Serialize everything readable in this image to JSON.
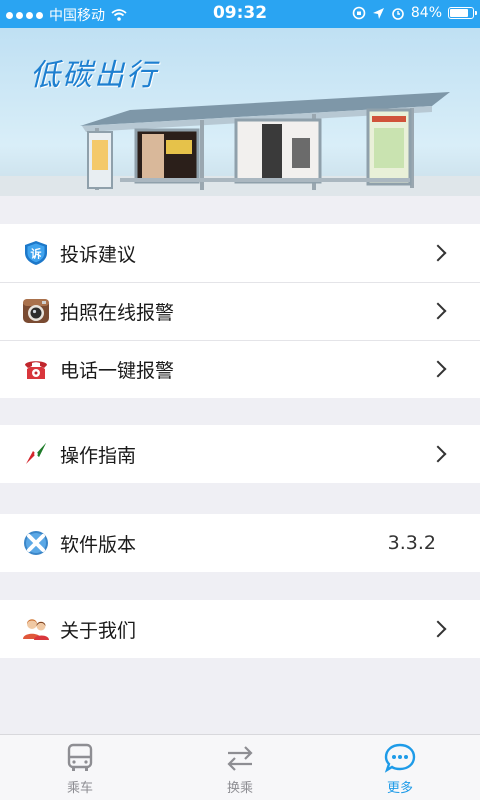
{
  "status_bar": {
    "carrier": "中国移动",
    "time": "09:32",
    "battery": "84%",
    "battery_level": 0.84
  },
  "banner": {
    "logo_text": "低碳出行"
  },
  "menu": {
    "complaint": {
      "label": "投诉建议",
      "icon": "complaint-shield-icon"
    },
    "photo_report": {
      "label": "拍照在线报警",
      "icon": "camera-icon"
    },
    "phone_report": {
      "label": "电话一键报警",
      "icon": "telephone-icon"
    },
    "guide": {
      "label": "操作指南",
      "icon": "compass-icon"
    },
    "version": {
      "label": "软件版本",
      "value": "3.3.2",
      "icon": "xbox-circle-icon"
    },
    "about": {
      "label": "关于我们",
      "icon": "users-icon"
    }
  },
  "tabbar": {
    "tabs": [
      {
        "label": "乘车",
        "icon": "bus-icon",
        "active": false
      },
      {
        "label": "换乘",
        "icon": "transfer-arrows-icon",
        "active": false
      },
      {
        "label": "更多",
        "icon": "more-chat-icon",
        "active": true
      }
    ]
  },
  "colors": {
    "accent": "#2aa4f2",
    "active_tab": "#1e9be8",
    "background": "#efeff4"
  }
}
